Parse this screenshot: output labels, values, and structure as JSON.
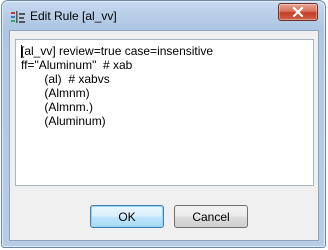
{
  "window": {
    "title": "Edit Rule [al_vv]",
    "close_label": "x"
  },
  "editor": {
    "lines": [
      "[al_vv] review=true case=insensitive",
      "ff=\"Aluminum\"  # xab",
      "       (al)  # xabvs",
      "       (Almnm)",
      "       (Almnm.)",
      "       (Aluminum)"
    ]
  },
  "buttons": {
    "ok": "OK",
    "cancel": "Cancel"
  },
  "icons": {
    "app": "rule-app-icon",
    "close": "close-icon"
  }
}
